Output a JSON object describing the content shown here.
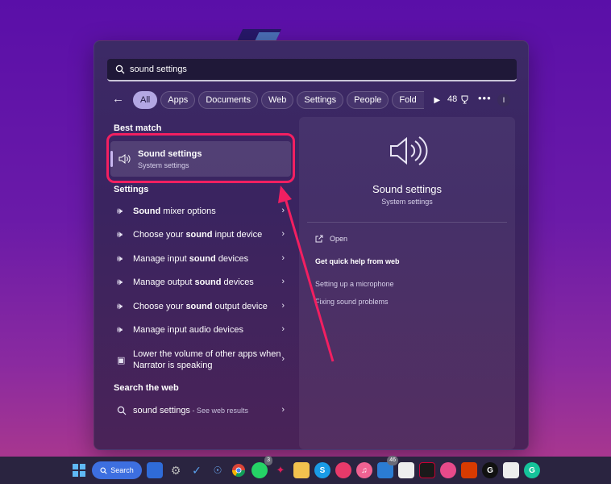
{
  "search": {
    "query": "sound settings"
  },
  "filters": {
    "items": [
      "All",
      "Apps",
      "Documents",
      "Web",
      "Settings",
      "People",
      "Fold"
    ],
    "active": "All",
    "count": "48",
    "more": "•••",
    "avatar": "I"
  },
  "best_match": {
    "heading": "Best match",
    "title": "Sound settings",
    "subtitle": "System settings"
  },
  "settings": {
    "heading": "Settings",
    "items": [
      {
        "pre": "",
        "bold": "Sound",
        "post": " mixer options"
      },
      {
        "pre": "Choose your ",
        "bold": "sound",
        "post": " input device"
      },
      {
        "pre": "Manage input ",
        "bold": "sound",
        "post": " devices"
      },
      {
        "pre": "Manage output ",
        "bold": "sound",
        "post": " devices"
      },
      {
        "pre": "Choose your ",
        "bold": "sound",
        "post": " output device"
      },
      {
        "pre": "Manage input audio devices",
        "bold": "",
        "post": ""
      },
      {
        "pre": "Lower the volume of other apps when Narrator is speaking",
        "bold": "",
        "post": ""
      }
    ]
  },
  "web": {
    "heading": "Search the web",
    "query": "sound settings",
    "suffix": " - See web results"
  },
  "detail": {
    "title": "Sound settings",
    "subtitle": "System settings",
    "open": "Open",
    "help_heading": "Get quick help from web",
    "links": [
      "Setting up a microphone",
      "Fixing sound problems"
    ]
  },
  "taskbar": {
    "search_label": "Search",
    "badges": {
      "whatsapp": "3",
      "mail": "46"
    },
    "icons": [
      "windows-icon",
      "search",
      "widgets-icon",
      "settings-icon",
      "todo-icon",
      "copilot-icon",
      "chrome-icon",
      "whatsapp-icon",
      "slack-icon",
      "explorer-icon",
      "skype-icon",
      "cast-icon",
      "music-icon",
      "mail-icon",
      "calendar-icon",
      "terminal-icon",
      "onenote-icon",
      "office-icon",
      "g-icon",
      "photo-icon",
      "grammarly-icon"
    ]
  },
  "colors": {
    "highlight": "#f21f61",
    "accent": "#b3a7e3",
    "taskbar_search": "#3d6fe0"
  }
}
